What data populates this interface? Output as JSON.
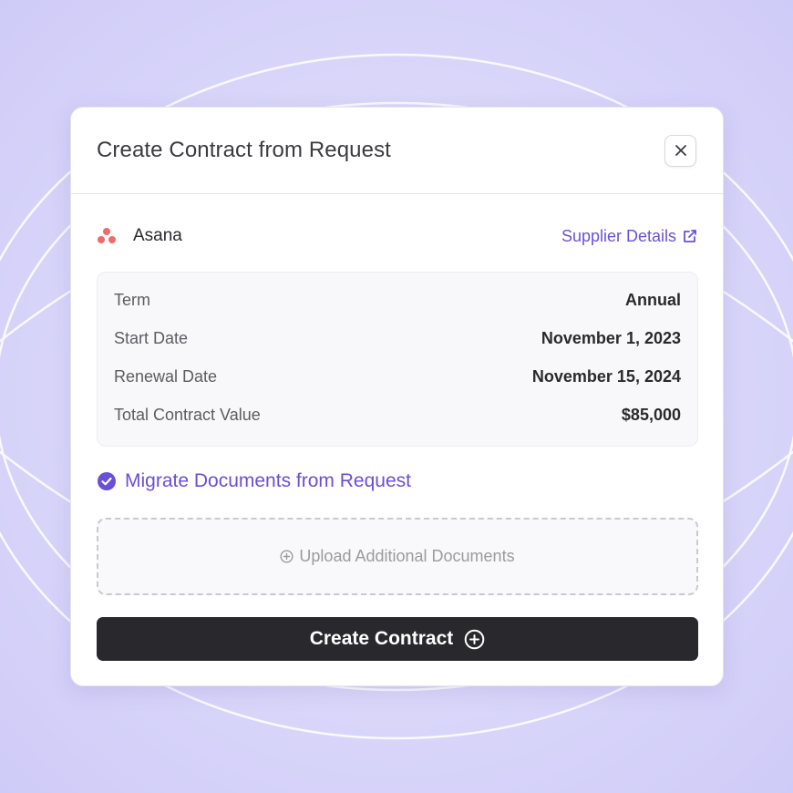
{
  "modal": {
    "title": "Create Contract from Request",
    "close_icon": "close-icon"
  },
  "supplier": {
    "name": "Asana",
    "logo_icon": "asana-logo",
    "details_link": "Supplier Details",
    "link_icon": "external-link-icon"
  },
  "details": [
    {
      "label": "Term",
      "value": "Annual"
    },
    {
      "label": "Start Date",
      "value": "November 1, 2023"
    },
    {
      "label": "Renewal Date",
      "value": "November 15, 2024"
    },
    {
      "label": "Total Contract Value",
      "value": "$85,000"
    }
  ],
  "migrate": {
    "label": "Migrate Documents from Request",
    "checked": true
  },
  "upload": {
    "label": "Upload Additional Documents",
    "icon": "plus-circle-icon"
  },
  "create_button": {
    "label": "Create Contract",
    "icon": "plus-circle-icon"
  },
  "colors": {
    "accent": "#6a4fd8",
    "button_bg": "#29282c",
    "asana": "#f06a6a"
  }
}
